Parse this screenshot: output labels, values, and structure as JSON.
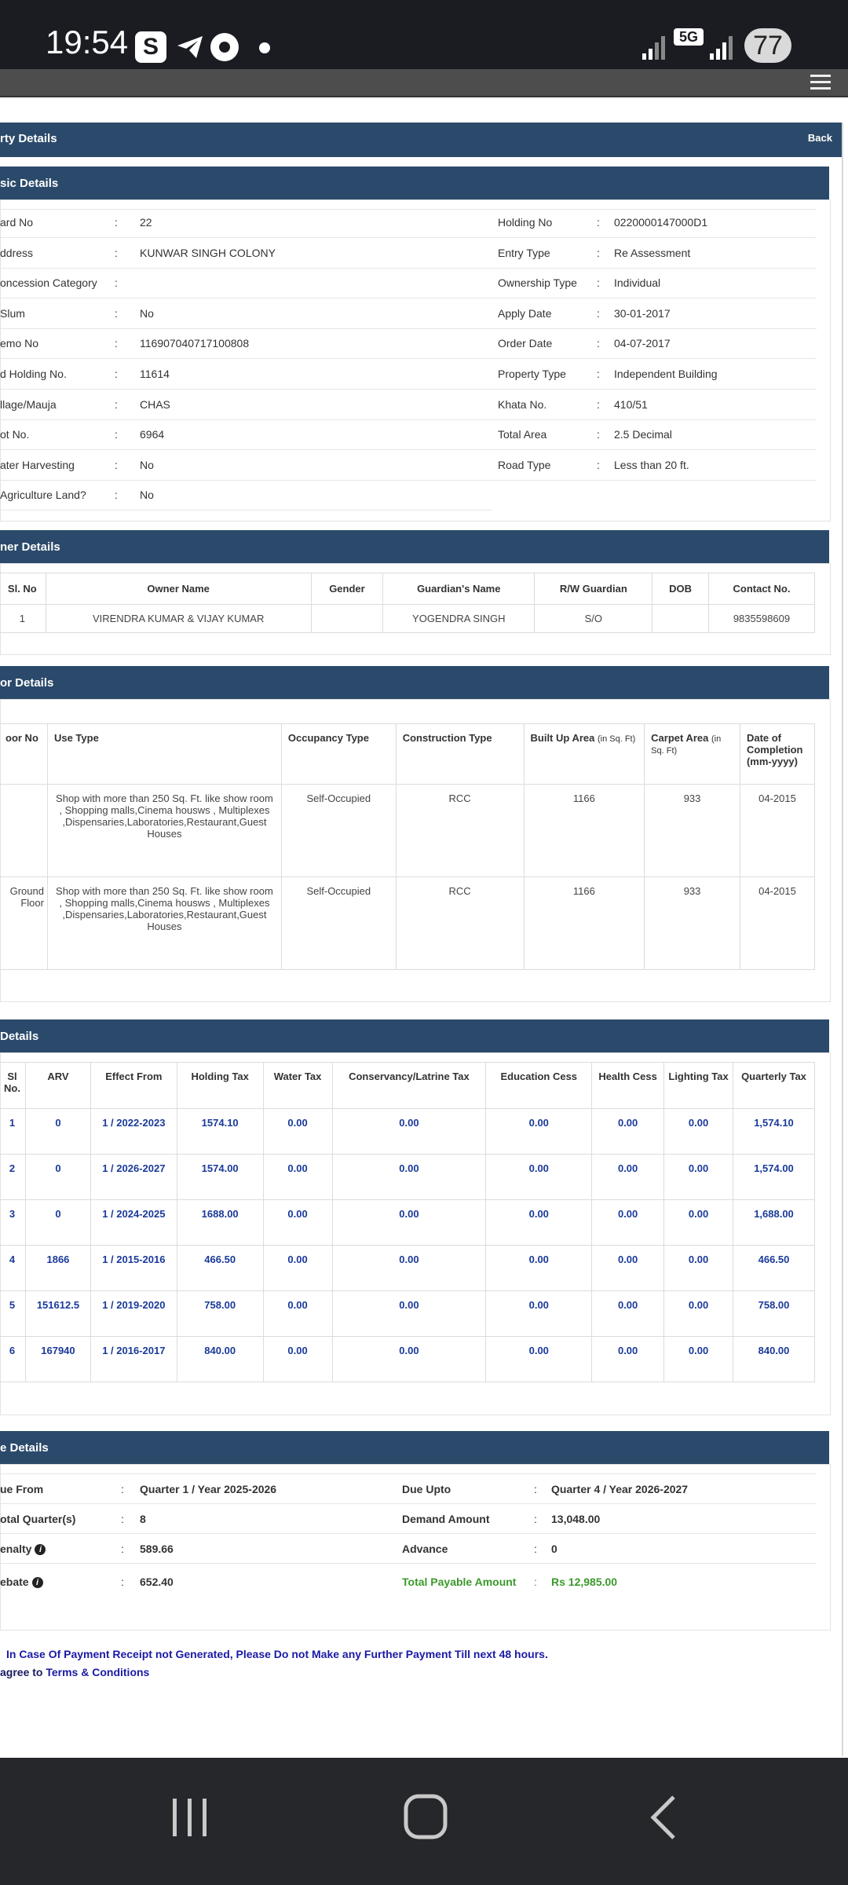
{
  "status": {
    "time": "19:54",
    "network": "5G",
    "battery": "77"
  },
  "page": {
    "title": "rty Details",
    "back_label": "Back"
  },
  "basic": {
    "title": "sic Details",
    "left": [
      {
        "label": "ard No",
        "value": "22"
      },
      {
        "label": "ddress",
        "value": "KUNWAR SINGH COLONY"
      },
      {
        "label": "oncession Category",
        "value": ""
      },
      {
        "label": "Slum",
        "value": "No"
      },
      {
        "label": "emo No",
        "value": "116907040717100808"
      },
      {
        "label": "d Holding No.",
        "value": "11614"
      },
      {
        "label": "llage/Mauja",
        "value": "CHAS"
      },
      {
        "label": "ot No.",
        "value": "6964"
      },
      {
        "label": "ater Harvesting",
        "value": "No"
      },
      {
        "label": "Agriculture Land?",
        "value": "No"
      }
    ],
    "right": [
      {
        "label": "Holding No",
        "value": "0220000147000D1"
      },
      {
        "label": "Entry Type",
        "value": "Re Assessment"
      },
      {
        "label": "Ownership Type",
        "value": "Individual"
      },
      {
        "label": "Apply Date",
        "value": "30-01-2017"
      },
      {
        "label": "Order Date",
        "value": "04-07-2017"
      },
      {
        "label": "Property Type",
        "value": "Independent Building"
      },
      {
        "label": "Khata No.",
        "value": "410/51"
      },
      {
        "label": "Total Area",
        "value": "2.5 Decimal"
      },
      {
        "label": "Road Type",
        "value": "Less than 20 ft."
      }
    ]
  },
  "owner": {
    "title": "ner Details",
    "headers": [
      "Sl. No",
      "Owner Name",
      "Gender",
      "Guardian's Name",
      "R/W Guardian",
      "DOB",
      "Contact No."
    ],
    "rows": [
      [
        "1",
        "VIRENDRA KUMAR & VIJAY KUMAR",
        "",
        "YOGENDRA SINGH",
        "S/O",
        "",
        "9835598609"
      ]
    ]
  },
  "floor": {
    "title": "or Details",
    "headers": [
      "oor No",
      "Use Type",
      "Occupancy Type",
      "Construction Type",
      "Built Up Area",
      "Carpet Area",
      "Date of Completion (mm-yyyy)"
    ],
    "header_units": [
      "",
      "",
      "",
      "",
      "(in Sq. Ft)",
      "(in Sq. Ft)",
      ""
    ],
    "rows": [
      [
        "",
        "Shop with more than 250 Sq. Ft. like show room , Shopping malls,Cinema housws , Multiplexes ,Dispensaries,Laboratories,Restaurant,Guest Houses",
        "Self-Occupied",
        "RCC",
        "1166",
        "933",
        "04-2015"
      ],
      [
        "Ground Floor",
        "Shop with more than 250 Sq. Ft. like show room , Shopping malls,Cinema housws , Multiplexes ,Dispensaries,Laboratories,Restaurant,Guest Houses",
        "Self-Occupied",
        "RCC",
        "1166",
        "933",
        "04-2015"
      ]
    ]
  },
  "tax": {
    "title": " Details",
    "headers": [
      "Sl No.",
      "ARV",
      "Effect From",
      "Holding Tax",
      "Water Tax",
      "Conservancy/Latrine Tax",
      "Education Cess",
      "Health Cess",
      "Lighting Tax",
      "Quarterly Tax"
    ],
    "rows": [
      [
        "1",
        "0",
        "1 / 2022-2023",
        "1574.10",
        "0.00",
        "0.00",
        "0.00",
        "0.00",
        "0.00",
        "1,574.10"
      ],
      [
        "2",
        "0",
        "1 / 2026-2027",
        "1574.00",
        "0.00",
        "0.00",
        "0.00",
        "0.00",
        "0.00",
        "1,574.00"
      ],
      [
        "3",
        "0",
        "1 / 2024-2025",
        "1688.00",
        "0.00",
        "0.00",
        "0.00",
        "0.00",
        "0.00",
        "1,688.00"
      ],
      [
        "4",
        "1866",
        "1 / 2015-2016",
        "466.50",
        "0.00",
        "0.00",
        "0.00",
        "0.00",
        "0.00",
        "466.50"
      ],
      [
        "5",
        "151612.5",
        "1 / 2019-2020",
        "758.00",
        "0.00",
        "0.00",
        "0.00",
        "0.00",
        "0.00",
        "758.00"
      ],
      [
        "6",
        "167940",
        "1 / 2016-2017",
        "840.00",
        "0.00",
        "0.00",
        "0.00",
        "0.00",
        "0.00",
        "840.00"
      ]
    ]
  },
  "due": {
    "title": "e Details",
    "rows": [
      {
        "l_label": "ue From",
        "l_value": "Quarter 1 / Year 2025-2026",
        "r_label": "Due Upto",
        "r_value": "Quarter 4 / Year 2026-2027"
      },
      {
        "l_label": "otal Quarter(s)",
        "l_value": "8",
        "r_label": "Demand Amount",
        "r_value": "13,048.00"
      },
      {
        "l_label": "enalty",
        "l_value": "589.66",
        "r_label": "Advance",
        "r_value": "0"
      },
      {
        "l_label": "ebate",
        "l_value": "652.40",
        "r_label": "Total Payable Amount",
        "r_value": "Rs 12,985.00"
      }
    ]
  },
  "notice": "In Case Of Payment Receipt not Generated, Please Do not Make any Further Payment Till next 48 hours.",
  "agree_prefix": "agree to",
  "terms_link": "Terms & Conditions",
  "colors": {
    "header": "#2b4a6b",
    "link": "#1a1aa6",
    "payable": "#3a9a2a"
  }
}
